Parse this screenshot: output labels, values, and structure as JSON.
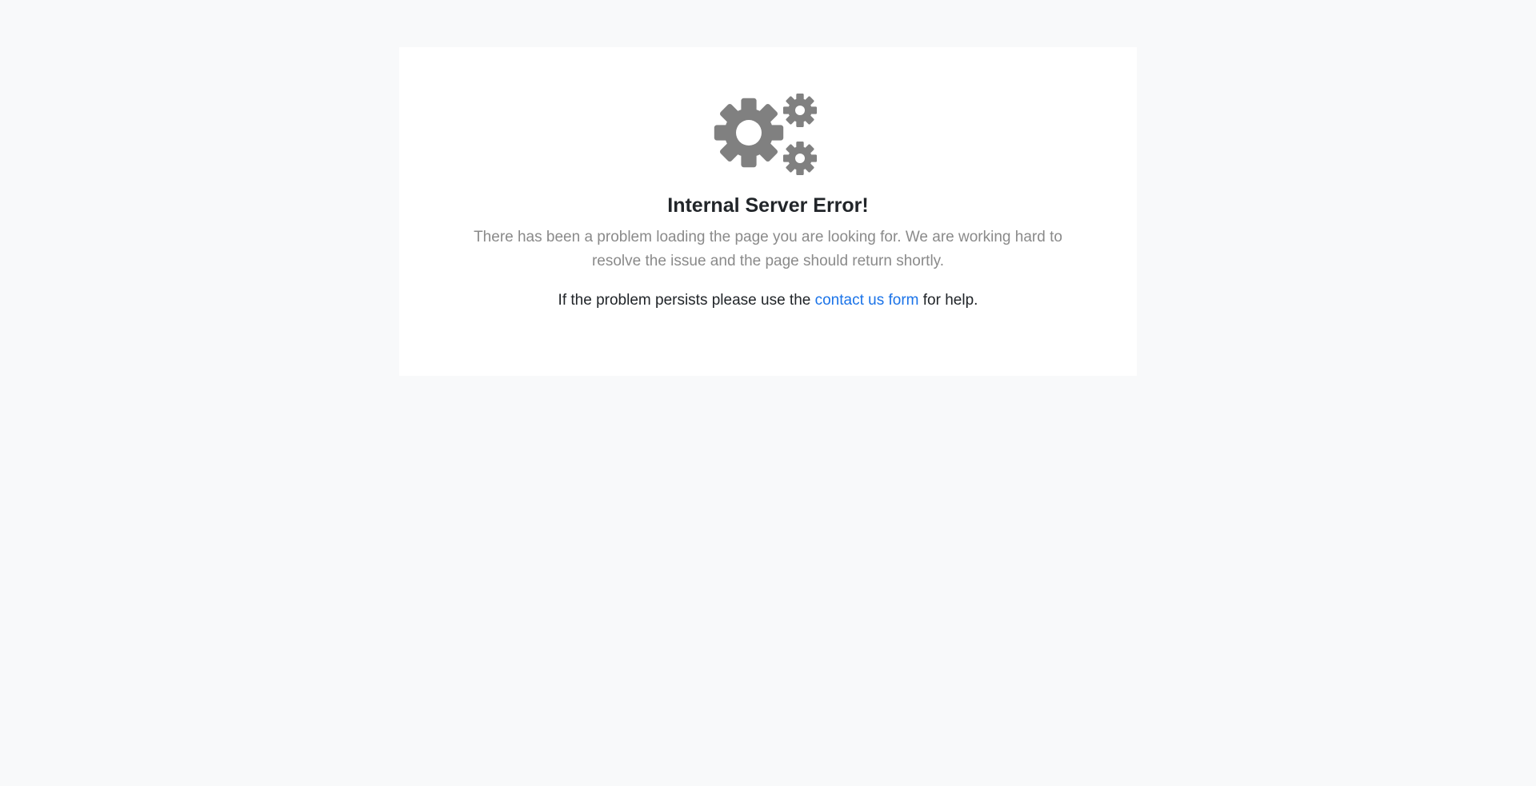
{
  "error": {
    "icon": "gears-icon",
    "icon_color": "#808080",
    "title": "Internal Server Error!",
    "message": "There has been a problem loading the page you are looking for. We are working hard to resolve the issue and the page should return shortly.",
    "help_prefix": "If the problem persists please use the ",
    "help_link": "contact us form",
    "help_suffix": " for help.",
    "link_color": "#1a73e8"
  }
}
